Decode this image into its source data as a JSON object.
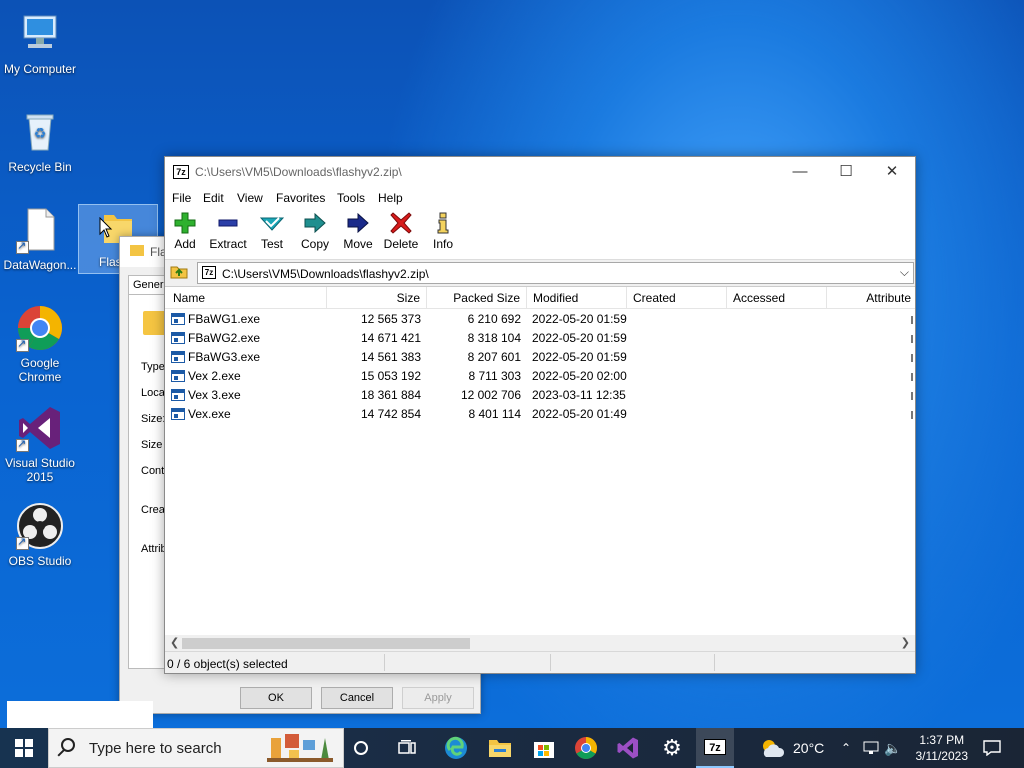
{
  "desktop": {
    "icons": [
      {
        "label": "My Computer"
      },
      {
        "label": "Recycle Bin"
      },
      {
        "label": "DataWagon..."
      },
      {
        "label": "Flas"
      },
      {
        "label": "Google Chrome"
      },
      {
        "label": "Visual Studio 2015"
      },
      {
        "label": "OBS Studio"
      }
    ]
  },
  "properties_dialog": {
    "title": "Fla",
    "tab": "Gener",
    "fields": [
      "Type",
      "Loca",
      "Size:",
      "Size",
      "Cont",
      "Crea",
      "Attrib"
    ],
    "ok": "OK",
    "cancel": "Cancel",
    "apply": "Apply"
  },
  "zip_window": {
    "app_icon": "7z",
    "title": "C:\\Users\\VM5\\Downloads\\flashyv2.zip\\",
    "controls": {
      "minimize": "—",
      "maximize": "☐",
      "close": "✕"
    },
    "menu": [
      "File",
      "Edit",
      "View",
      "Favorites",
      "Tools",
      "Help"
    ],
    "toolbar": [
      {
        "label": "Add",
        "icon": "add-icon"
      },
      {
        "label": "Extract",
        "icon": "extract-icon"
      },
      {
        "label": "Test",
        "icon": "test-icon"
      },
      {
        "label": "Copy",
        "icon": "copy-icon"
      },
      {
        "label": "Move",
        "icon": "move-icon"
      },
      {
        "label": "Delete",
        "icon": "delete-icon"
      },
      {
        "label": "Info",
        "icon": "info-icon"
      }
    ],
    "address": "C:\\Users\\VM5\\Downloads\\flashyv2.zip\\",
    "columns": [
      "Name",
      "Size",
      "Packed Size",
      "Modified",
      "Created",
      "Accessed",
      "Attribute"
    ],
    "files": [
      {
        "name": "FBaWG1.exe",
        "size": "12 565 373",
        "packed": "6 210 692",
        "modified": "2022-05-20 01:59"
      },
      {
        "name": "FBaWG2.exe",
        "size": "14 671 421",
        "packed": "8 318 104",
        "modified": "2022-05-20 01:59"
      },
      {
        "name": "FBaWG3.exe",
        "size": "14 561 383",
        "packed": "8 207 601",
        "modified": "2022-05-20 01:59"
      },
      {
        "name": "Vex 2.exe",
        "size": "15 053 192",
        "packed": "8 711 303",
        "modified": "2022-05-20 02:00"
      },
      {
        "name": "Vex 3.exe",
        "size": "18 361 884",
        "packed": "12 002 706",
        "modified": "2023-03-11 12:35"
      },
      {
        "name": "Vex.exe",
        "size": "14 742 854",
        "packed": "8 401 114",
        "modified": "2022-05-20 01:49"
      }
    ],
    "status": "0 / 6 object(s) selected"
  },
  "taskbar": {
    "search_placeholder": "Type here to search",
    "weather": "20°C",
    "time": "1:37 PM",
    "date": "3/11/2023"
  },
  "colors": {
    "desktop_blue": "#0a63d0",
    "add_green": "#2fb12f",
    "delete_red": "#d81b1b",
    "navy": "#1a2a8a",
    "teal": "#1aa7b8"
  }
}
